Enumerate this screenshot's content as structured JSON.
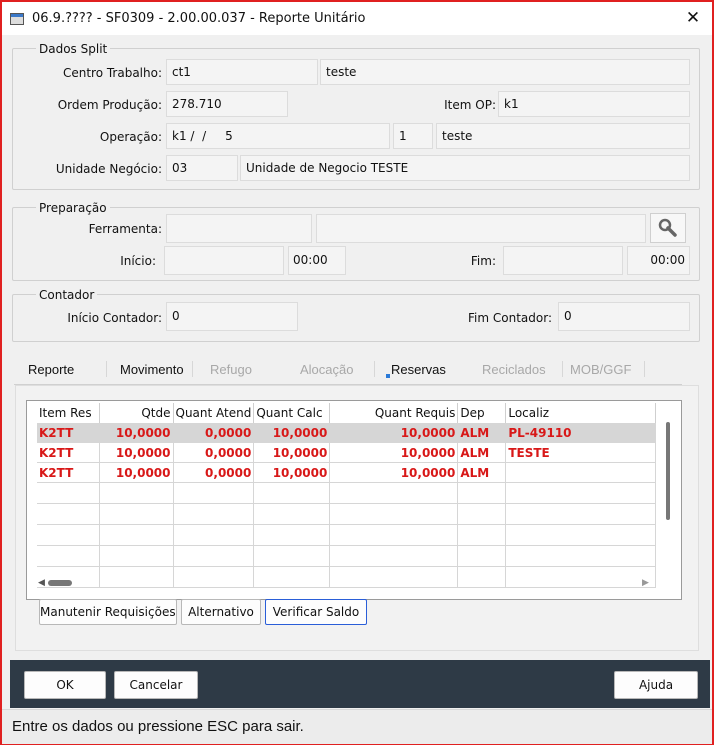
{
  "window": {
    "title": "06.9.???? - SF0309 - 2.00.00.037 - Reporte Unitário",
    "close_glyph": "✕"
  },
  "dados_split": {
    "legend": "Dados Split",
    "centro_trabalho_label": "Centro Trabalho:",
    "centro_trabalho_value": "ct1",
    "centro_trabalho_desc": "teste",
    "ordem_producao_label": "Ordem Produção:",
    "ordem_producao_value": "278.710",
    "item_op_label": "Item OP:",
    "item_op_value": "k1",
    "operacao_label": "Operação:",
    "operacao_value": "k1 /  /     5",
    "operacao_seq": "1",
    "operacao_desc": "teste",
    "unidade_negocio_label": "Unidade Negócio:",
    "unidade_negocio_value": "03",
    "unidade_negocio_desc": "Unidade de Negocio TESTE"
  },
  "preparacao": {
    "legend": "Preparação",
    "ferramenta_label": "Ferramenta:",
    "ferramenta_value": "",
    "ferramenta_desc": "",
    "inicio_label": "Início:",
    "inicio_date": "",
    "inicio_time": "00:00",
    "fim_label": "Fim:",
    "fim_date": "",
    "fim_time": "00:00",
    "search_icon": "wrench-search-icon"
  },
  "contador": {
    "legend": "Contador",
    "inicio_label": "Início Contador:",
    "inicio_value": "0",
    "fim_label": "Fim Contador:",
    "fim_value": "0"
  },
  "tabs": [
    {
      "label": "Reporte",
      "state": "active"
    },
    {
      "label": "Movimento",
      "state": "active"
    },
    {
      "label": "Refugo",
      "state": "disabled"
    },
    {
      "label": "Alocação",
      "state": "disabled"
    },
    {
      "label": "Reservas",
      "state": "active"
    },
    {
      "label": "Reciclados",
      "state": "disabled"
    },
    {
      "label": "MOB/GGF",
      "state": "disabled"
    }
  ],
  "grid": {
    "columns": [
      "Item Res",
      "Qtde",
      "Quant Atend",
      "Quant Calc",
      "Quant Requis",
      "Dep",
      "Localiz"
    ],
    "rows": [
      [
        "K2TT",
        "10,0000",
        "0,0000",
        "10,0000",
        "10,0000",
        "ALM",
        "PL-49110"
      ],
      [
        "K2TT",
        "10,0000",
        "0,0000",
        "10,0000",
        "10,0000",
        "ALM",
        "TESTE"
      ],
      [
        "K2TT",
        "10,0000",
        "0,0000",
        "10,0000",
        "10,0000",
        "ALM",
        ""
      ]
    ],
    "row_color": "#d81818"
  },
  "grid_buttons": {
    "manutenir": "Manutenir Requisições",
    "alternativo": "Alternativo",
    "verificar_saldo": "Verificar Saldo"
  },
  "footer": {
    "ok": "OK",
    "cancelar": "Cancelar",
    "ajuda": "Ajuda"
  },
  "status": {
    "text": "Entre os dados ou pressione ESC para sair."
  },
  "colors": {
    "border": "#e02020",
    "footer_bg": "#2e3a46",
    "focus": "#2a5ed8"
  }
}
